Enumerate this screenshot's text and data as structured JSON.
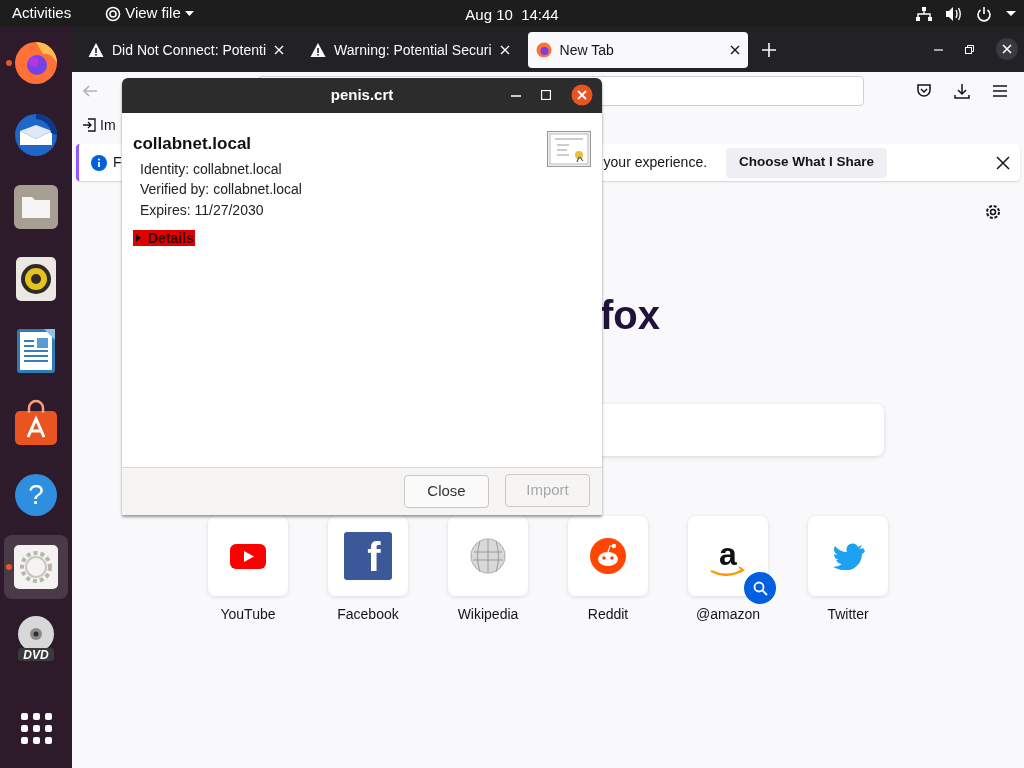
{
  "top_bar": {
    "activities": "Activities",
    "app_menu": "View file",
    "clock": "Aug 10  14:44"
  },
  "dock": {
    "apps": [
      {
        "kind": "firefox",
        "running": true,
        "selected": false
      },
      {
        "kind": "thunderbird",
        "running": false,
        "selected": false
      },
      {
        "kind": "files",
        "running": false,
        "selected": false
      },
      {
        "kind": "rhythmbox",
        "running": false,
        "selected": false
      },
      {
        "kind": "writer",
        "running": false,
        "selected": false
      },
      {
        "kind": "software",
        "running": false,
        "selected": false
      },
      {
        "kind": "help",
        "glyph": "?",
        "running": false,
        "selected": false
      },
      {
        "kind": "settings",
        "running": true,
        "selected": true
      },
      {
        "kind": "dvd",
        "glyph": "DVD",
        "running": false,
        "selected": false
      }
    ]
  },
  "browser": {
    "tabs": [
      {
        "title": "Did Not Connect: Potenti",
        "kind": "warning",
        "selected": false
      },
      {
        "title": "Warning: Potential Securi",
        "kind": "warning",
        "selected": false
      },
      {
        "title": "New Tab",
        "kind": "newtab",
        "selected": true
      }
    ],
    "bookmarks": [
      {
        "label": "Im"
      }
    ],
    "notice": {
      "text_start": "F",
      "text_end": "your experience.",
      "button": "Choose What I Share"
    },
    "wordmark": "fox",
    "shortcuts": [
      {
        "label": "YouTube",
        "kind": "youtube"
      },
      {
        "label": "Facebook",
        "kind": "facebook",
        "glyph": "f"
      },
      {
        "label": "Wikipedia",
        "kind": "wikipedia"
      },
      {
        "label": "Reddit",
        "kind": "reddit"
      },
      {
        "label": "@amazon",
        "kind": "amazon",
        "glyph": "a",
        "search_badge": true
      },
      {
        "label": "Twitter",
        "kind": "twitter"
      }
    ]
  },
  "dialog": {
    "title": "penis.crt",
    "subject": "collabnet.local",
    "fields": [
      "Identity: collabnet.local",
      "Verified by: collabnet.local",
      "Expires: 11/27/2030"
    ],
    "details": {
      "label": "Details",
      "expanded": false,
      "focused": true
    },
    "buttons": [
      {
        "label": "Close",
        "disabled": false
      },
      {
        "label": "Import",
        "disabled": true
      }
    ]
  }
}
